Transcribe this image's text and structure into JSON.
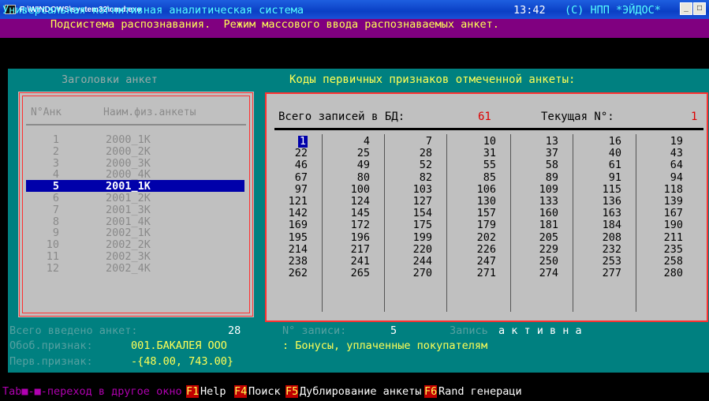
{
  "window": {
    "title": "F:\\WINDOWS\\system32\\cmd.exe",
    "minimize": "_",
    "maximize": "□"
  },
  "header": {
    "system_name": "Универсальная когнитивная аналитическая система",
    "time": "13:42",
    "copyright": "(C) НПП *ЭЙДОС*",
    "subtitle": "Подсистема распознавания.  Режим массового ввода распознаваемых анкет."
  },
  "left_panel": {
    "title": "Заголовки анкет",
    "col_num": "N°Анк",
    "col_name": "Наим.физ.анкеты",
    "items": [
      {
        "n": "1",
        "name": "2000_1K"
      },
      {
        "n": "2",
        "name": "2000_2K"
      },
      {
        "n": "3",
        "name": "2000_3K"
      },
      {
        "n": "4",
        "name": "2000_4K"
      },
      {
        "n": "5",
        "name": "2001_1K"
      },
      {
        "n": "6",
        "name": "2001_2K"
      },
      {
        "n": "7",
        "name": "2001_3K"
      },
      {
        "n": "8",
        "name": "2001_4K"
      },
      {
        "n": "9",
        "name": "2002_1K"
      },
      {
        "n": "10",
        "name": "2002_2K"
      },
      {
        "n": "11",
        "name": "2002_3K"
      },
      {
        "n": "12",
        "name": "2002_4K"
      }
    ],
    "selected_index": 4
  },
  "right_panel": {
    "title": "Коды первичных признаков отмеченной анкеты:",
    "total_label": "Всего записей в БД:",
    "total_value": "61",
    "current_label": "Текущая N°:",
    "current_value": "1",
    "columns": [
      [
        "1",
        "22",
        "46",
        "67",
        "97",
        "121",
        "142",
        "169",
        "195",
        "214",
        "238",
        "262"
      ],
      [
        "4",
        "25",
        "49",
        "80",
        "100",
        "124",
        "145",
        "172",
        "196",
        "217",
        "241",
        "265"
      ],
      [
        "7",
        "28",
        "52",
        "82",
        "103",
        "127",
        "154",
        "175",
        "199",
        "220",
        "244",
        "270"
      ],
      [
        "10",
        "31",
        "55",
        "85",
        "106",
        "130",
        "157",
        "179",
        "202",
        "226",
        "247",
        "271"
      ],
      [
        "13",
        "37",
        "58",
        "89",
        "109",
        "133",
        "160",
        "181",
        "205",
        "229",
        "250",
        "274"
      ],
      [
        "16",
        "40",
        "61",
        "91",
        "115",
        "136",
        "163",
        "184",
        "208",
        "232",
        "253",
        "277"
      ],
      [
        "19",
        "43",
        "64",
        "94",
        "118",
        "139",
        "167",
        "190",
        "211",
        "235",
        "258",
        "280"
      ]
    ]
  },
  "bottom": {
    "entered_label": "Всего введено анкет:",
    "entered_value": "28",
    "record_label": "N° записи:",
    "record_value": "5",
    "record_state_label": "Запись",
    "record_state_value": "а к т и в н а",
    "class_label": "Обоб.признак:",
    "class_value": "001.БАКАЛЕЯ ООО",
    "class_desc": ": Бонусы, уплаченные покупателям",
    "prim_label": "Перв.признак:",
    "prim_value": "-{48.00, 743.00}"
  },
  "statusbar": {
    "tab_hint": "Tab■-■-переход в другое окно",
    "f1_key": "F1",
    "f1_label": "Help",
    "f4_key": "F4",
    "f4_label": "Поиск",
    "f5_key": "F5",
    "f5_label": "Дублирование анкеты",
    "f6_key": "F6",
    "f6_label": "Rand генераци"
  }
}
